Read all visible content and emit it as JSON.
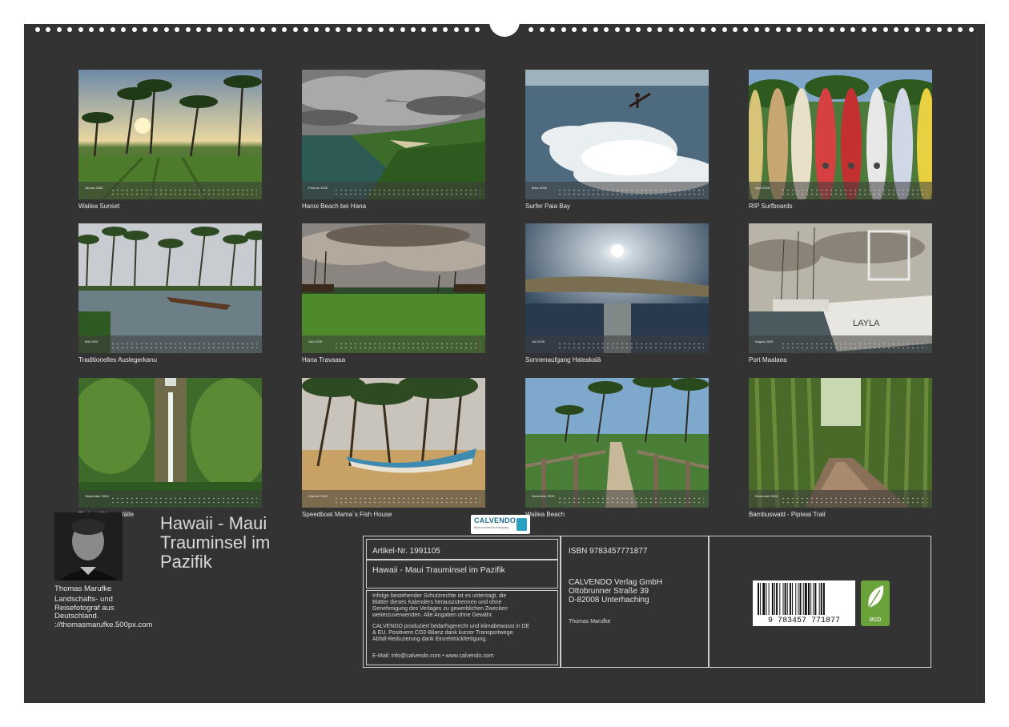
{
  "tiles": [
    {
      "month": "Januar 2026",
      "caption": "Wailea Sunset"
    },
    {
      "month": "Februar 2026",
      "caption": "Hanoi Beach bei Hana"
    },
    {
      "month": "März 2026",
      "caption": "Surfer Paia Bay"
    },
    {
      "month": "April 2026",
      "caption": "RIP Surfboards"
    },
    {
      "month": "Mai 2026",
      "caption": "Traditionelles Auslegerkanu"
    },
    {
      "month": "Juni 2026",
      "caption": "Hana Travaasa"
    },
    {
      "month": "Juli 2026",
      "caption": "Sonnenaufgang Haleakalā"
    },
    {
      "month": "August 2026",
      "caption": "Port Maalaea"
    },
    {
      "month": "September 2026",
      "caption": "Pipiwai Wasserfälle"
    },
    {
      "month": "Oktober 2026",
      "caption": "Speedboat Mama´s Fish House"
    },
    {
      "month": "November 2026",
      "caption": "Wailea Beach"
    },
    {
      "month": "Dezember 2026",
      "caption": "Bambuswald - Pipiwai Trail"
    }
  ],
  "author": {
    "name": "Thomas Marufke",
    "desc_lines": [
      "Landschafts- und",
      "Reisefotograf aus",
      "Deutschland.",
      "://thomasmarufke.500px.com"
    ]
  },
  "calendar_title_lines": [
    "Hawaii - Maui",
    "Trauminsel im",
    "Pazifik"
  ],
  "info": {
    "article_no": "Artikel-Nr. 1991105",
    "title": "Hawaii - Maui Trauminsel im Pazifik",
    "legal_1": [
      "Infolge bestehender Schutzrechte ist es untersagt, die",
      "Blätter dieses Kalenders herauszutrennen und ohne",
      "Genehmigung des Verlages zu gewerblichen Zwecken",
      "weiterzuverwenden. Alle Angaben ohne Gewähr."
    ],
    "legal_2": [
      "CALVENDO produziert bedarfsgerecht und klimabewusst in DE",
      "& EU. Positivere CO2-Bilanz dank kurzer Transportwege.",
      "Abfall-Reduzierung dank Einzelstückfertigung."
    ],
    "contact": "E-Mail: info@calvendo.com • www.calvendo.com",
    "isbn": "ISBN 9783457771877",
    "publisher_lines": [
      "CALVENDO Verlag GmbH",
      "Ottobrunner Straße 39",
      "D-82008 Unterhaching"
    ],
    "photographer": "Thomas Marufke",
    "barcode_digits": "9 783457 771877",
    "logo_text": "CALVENDO",
    "logo_tagline": "Best moments everyday",
    "eco_text": "eco"
  }
}
